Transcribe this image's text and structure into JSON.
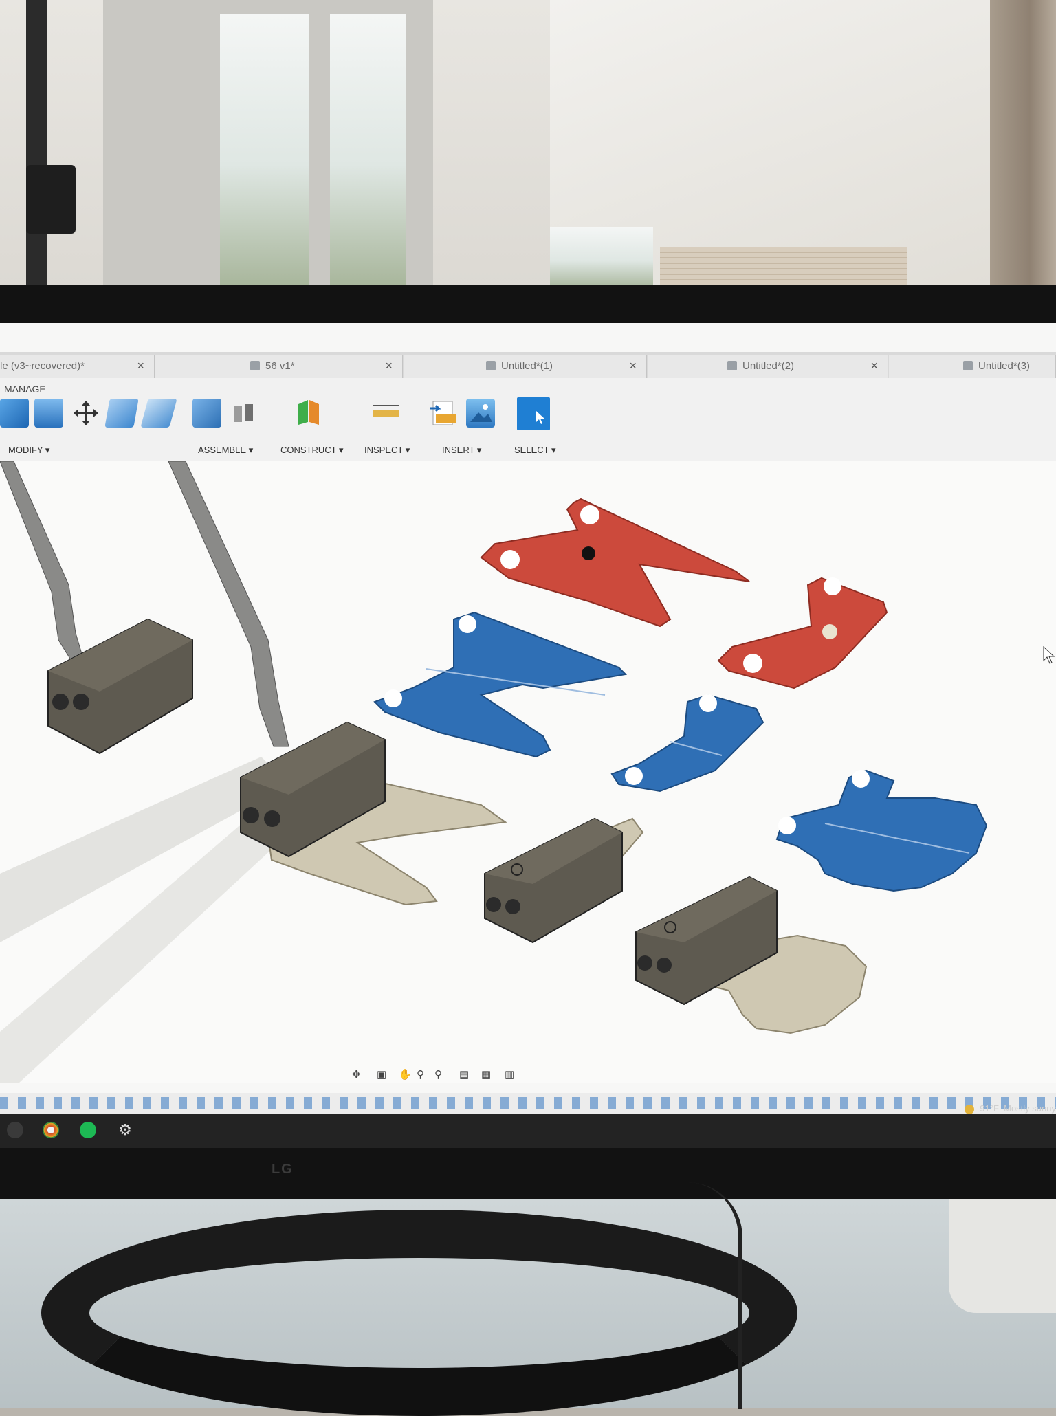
{
  "tabs": [
    {
      "label": "le (v3~recovered)*"
    },
    {
      "label": "56 v1*"
    },
    {
      "label": "Untitled*(1)"
    },
    {
      "label": "Untitled*(2)"
    },
    {
      "label": "Untitled*(3)"
    }
  ],
  "tab_close_glyph": "×",
  "toolbar": {
    "manage_label": "MANAGE",
    "groups": {
      "modify": "MODIFY ▾",
      "assemble": "ASSEMBLE ▾",
      "construct": "CONSTRUCT ▾",
      "inspect": "INSPECT ▾",
      "insert": "INSERT ▾",
      "select": "SELECT ▾"
    }
  },
  "monitor_brand": "LG",
  "status": {
    "weather_temp": "91°F",
    "weather_desc": "Mostly sunny"
  },
  "colors": {
    "red_part": "#cc4a3c",
    "blue_part": "#2f6fb5",
    "body_grey": "#5e5a50",
    "plate_tan": "#cfc8b2",
    "select_accent": "#1f7fd3"
  }
}
